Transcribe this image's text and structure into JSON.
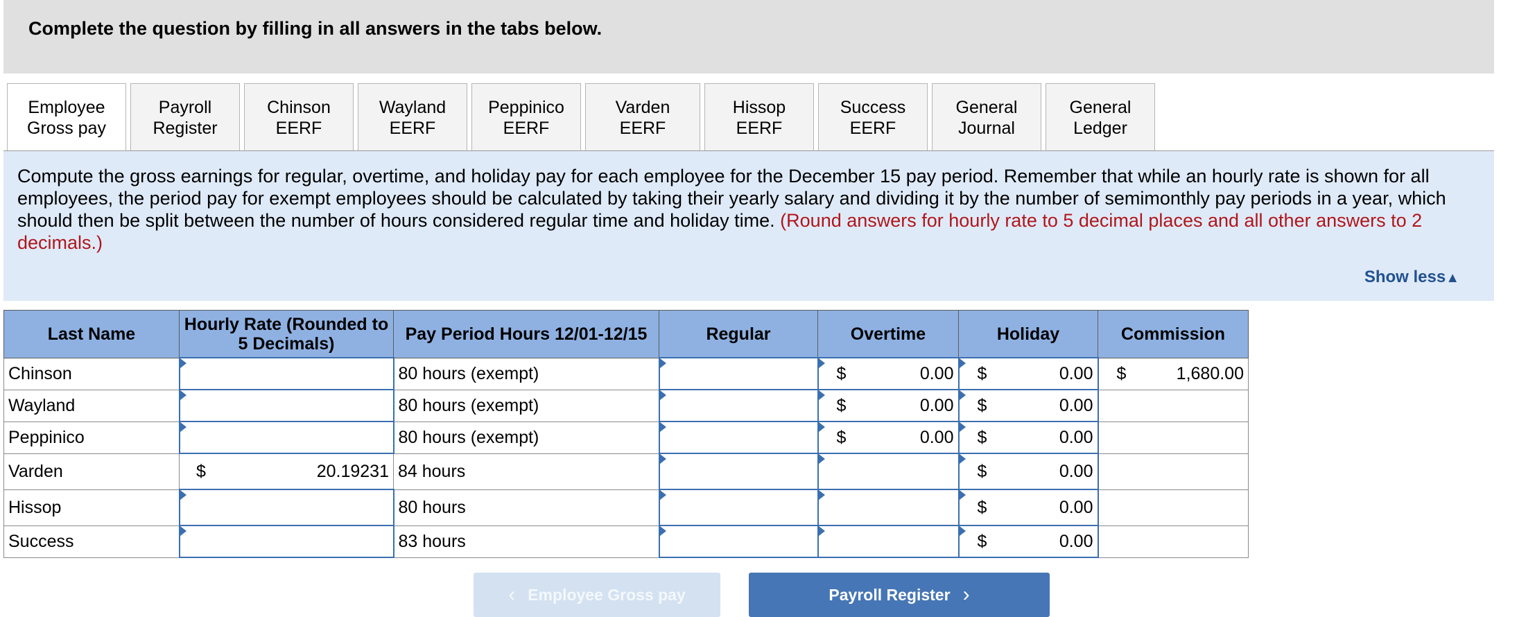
{
  "header": {
    "title": "Complete the question by filling in all answers in the tabs below."
  },
  "tabs": [
    {
      "label": "Employee\nGross pay",
      "active": true
    },
    {
      "label": "Payroll\nRegister"
    },
    {
      "label": "Chinson\nEERF"
    },
    {
      "label": "Wayland\nEERF"
    },
    {
      "label": "Peppinico\nEERF"
    },
    {
      "label": "Varden EERF"
    },
    {
      "label": "Hissop EERF"
    },
    {
      "label": "Success\nEERF"
    },
    {
      "label": "General\nJournal"
    },
    {
      "label": "General\nLedger"
    }
  ],
  "instructions": {
    "text": "Compute the gross earnings for regular, overtime, and holiday pay for each employee for the December 15 pay period. Remember that while an hourly rate is shown for all employees, the period pay for exempt employees should be calculated by taking their yearly salary and dividing it by the number of semimonthly pay periods in a year, which should then be split between the number of hours considered regular time and holiday time.",
    "note": "(Round answers for hourly rate to 5 decimal places and all other answers to 2 decimals.)",
    "show_less": "Show less"
  },
  "table": {
    "headers": {
      "name": "Last Name",
      "rate": "Hourly Rate (Rounded to 5 Decimals)",
      "hours": "Pay Period Hours 12/01-12/15",
      "regular": "Regular",
      "overtime": "Overtime",
      "holiday": "Holiday",
      "commission": "Commission"
    },
    "rows": [
      {
        "name": "Chinson",
        "hours": "80 hours (exempt)",
        "ot_sign": "$",
        "ot": "0.00",
        "hol_sign": "$",
        "hol": "0.00",
        "com_sign": "$",
        "com": "1,680.00"
      },
      {
        "name": "Wayland",
        "hours": "80 hours (exempt)",
        "ot_sign": "$",
        "ot": "0.00",
        "hol_sign": "$",
        "hol": "0.00"
      },
      {
        "name": "Peppinico",
        "hours": "80 hours (exempt)",
        "ot_sign": "$",
        "ot": "0.00",
        "hol_sign": "$",
        "hol": "0.00"
      },
      {
        "name": "Varden",
        "rate_sign": "$",
        "rate": "20.19231",
        "hours": "84 hours",
        "hol_sign": "$",
        "hol": "0.00"
      },
      {
        "name": "Hissop",
        "hours": "80 hours",
        "hol_sign": "$",
        "hol": "0.00"
      },
      {
        "name": "Success",
        "hours": "83 hours",
        "hol_sign": "$",
        "hol": "0.00"
      }
    ]
  },
  "nav": {
    "prev_label": "Employee Gross pay",
    "next_label": "Payroll Register"
  }
}
